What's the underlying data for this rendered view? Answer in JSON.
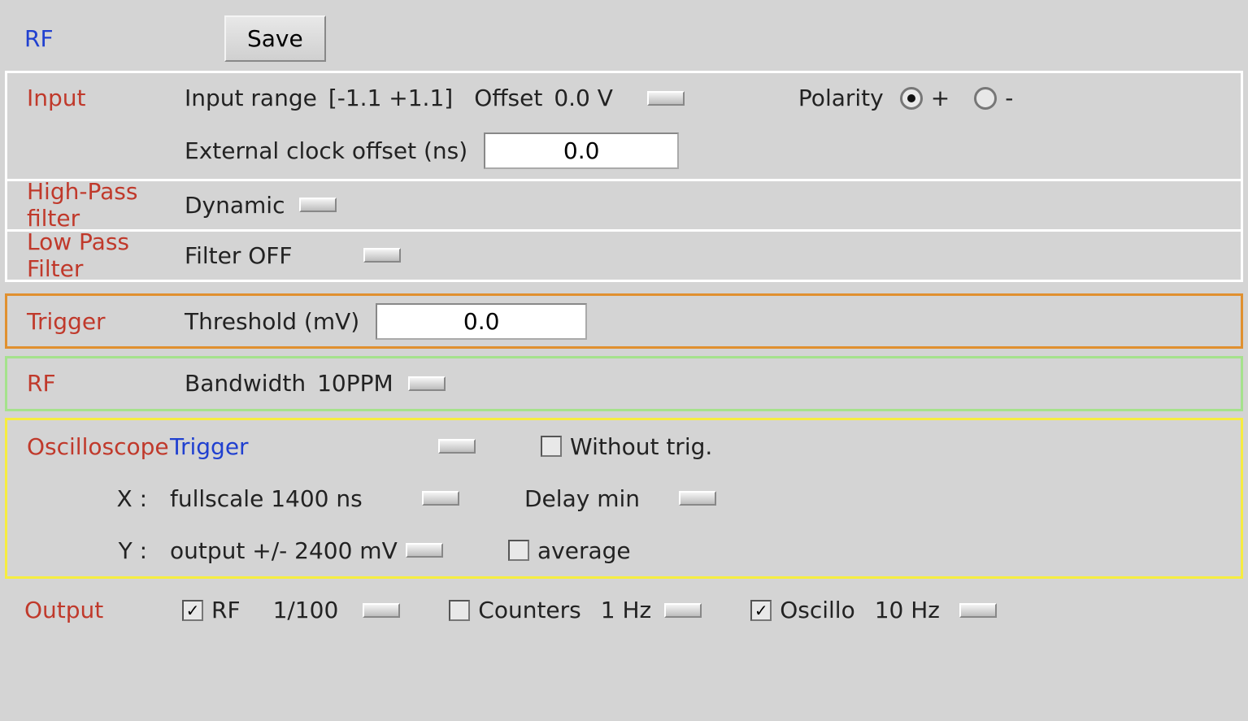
{
  "header": {
    "title": "RF",
    "save_label": "Save"
  },
  "input": {
    "label": "Input",
    "range_label": "Input range",
    "range_value": "[-1.1 +1.1]",
    "offset_label": "Offset",
    "offset_value": "0.0 V",
    "polarity_label": "Polarity",
    "polarity_plus": "+",
    "polarity_minus": "-",
    "polarity_selected": "plus",
    "ext_clock_label": "External clock offset (ns)",
    "ext_clock_value": "0.0"
  },
  "highpass": {
    "label": "High-Pass filter",
    "value": "Dynamic"
  },
  "lowpass": {
    "label": "Low Pass Filter",
    "value": "Filter OFF"
  },
  "trigger": {
    "label": "Trigger",
    "threshold_label": "Threshold (mV)",
    "threshold_value": "0.0"
  },
  "rf": {
    "label": "RF",
    "bandwidth_label": "Bandwidth",
    "bandwidth_value": "10PPM"
  },
  "oscillo": {
    "label": "Oscilloscope",
    "trigger_label": "Trigger",
    "without_trig_label": "Without trig.",
    "without_trig_checked": false,
    "x_label": "X :",
    "x_value": "fullscale 1400 ns",
    "delay_label": "Delay min",
    "y_label": "Y :",
    "y_value": "output +/- 2400 mV",
    "average_label": "average",
    "average_checked": false
  },
  "output": {
    "label": "Output",
    "rf_label": "RF",
    "rf_checked": true,
    "rf_rate": "1/100",
    "counters_label": "Counters",
    "counters_checked": false,
    "counters_rate": "1 Hz",
    "oscillo_label": "Oscillo",
    "oscillo_checked": true,
    "oscillo_rate": "10 Hz"
  }
}
